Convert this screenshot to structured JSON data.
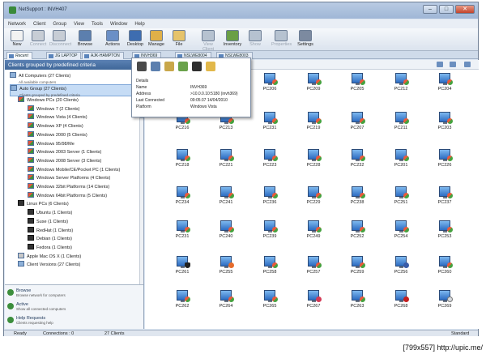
{
  "window": {
    "title": "NetSupport : INVH407"
  },
  "menu": [
    "Network",
    "Client",
    "Group",
    "View",
    "Tools",
    "Window",
    "Help"
  ],
  "toolbar": [
    {
      "label": "New",
      "icon": "new-icon",
      "enabled": true
    },
    {
      "label": "Connect",
      "icon": "connect-icon",
      "enabled": false
    },
    {
      "label": "Disconnect",
      "icon": "disconnect-icon",
      "enabled": false
    },
    {
      "label": "Browse",
      "icon": "browse-icon",
      "enabled": true
    },
    {
      "label": "Actions",
      "icon": "actions-icon",
      "enabled": true
    },
    {
      "label": "Desktop",
      "icon": "desktop-icon",
      "enabled": true
    },
    {
      "label": "Manage",
      "icon": "manage-icon",
      "enabled": true
    },
    {
      "label": "File",
      "icon": "file-icon",
      "enabled": true
    },
    {
      "label": "View Client",
      "icon": "view-client-icon",
      "enabled": false
    },
    {
      "label": "Inventory",
      "icon": "inventory-icon",
      "enabled": true
    },
    {
      "label": "Show",
      "icon": "show-icon",
      "enabled": false
    },
    {
      "label": "Properties",
      "icon": "properties-icon",
      "enabled": false
    },
    {
      "label": "Settings",
      "icon": "settings-icon",
      "enabled": true
    }
  ],
  "tabs": [
    "Recent",
    "JG LAPTOP",
    "AJK-HAMPTON",
    "INVH369",
    "NSLWE8004",
    "NSLWE8003"
  ],
  "left_panel": {
    "title": "Clients grouped by predefined criteria",
    "tree": [
      {
        "label": "All Computers (27 Clients)",
        "sub": "All available computers",
        "icon": "computer"
      },
      {
        "label": "Auto Group (27 Clients)",
        "sub": "Clients grouped by predefined criteria",
        "icon": "group",
        "selected": true
      },
      {
        "label": "Windows PCs (20 Clients)",
        "icon": "win"
      },
      {
        "label": "Windows 7 (2 Clients)",
        "icon": "win"
      },
      {
        "label": "Windows Vista (4 Clients)",
        "icon": "win"
      },
      {
        "label": "Windows XP (4 Clients)",
        "icon": "win"
      },
      {
        "label": "Windows 2000 (5 Clients)",
        "icon": "win"
      },
      {
        "label": "Windows 95/98/Me",
        "icon": "win"
      },
      {
        "label": "Windows 2003 Server (1 Clients)",
        "icon": "win"
      },
      {
        "label": "Windows 2008 Server (3 Clients)",
        "icon": "win"
      },
      {
        "label": "Windows Mobile/CE/Pocket PC (1 Clients)",
        "icon": "win"
      },
      {
        "label": "Windows Server Platforms (4 Clients)",
        "icon": "win"
      },
      {
        "label": "Windows 32bit Platforms (14 Clients)",
        "icon": "win"
      },
      {
        "label": "Windows 64bit Platforms (5 Clients)",
        "icon": "win"
      },
      {
        "label": "Linux PCs (6 Clients)",
        "icon": "lin"
      },
      {
        "label": "Ubuntu (1 Clients)",
        "icon": "lin"
      },
      {
        "label": "Suse (1 Clients)",
        "icon": "lin"
      },
      {
        "label": "RedHat (1 Clients)",
        "icon": "lin"
      },
      {
        "label": "Debian (1 Clients)",
        "icon": "lin"
      },
      {
        "label": "Fedora (1 Clients)",
        "icon": "lin"
      },
      {
        "label": "Apple Mac OS X (1 Clients)",
        "icon": "apple"
      },
      {
        "label": "Client Versions (27 Clients)",
        "icon": "group"
      }
    ],
    "footer": [
      {
        "label": "Browse",
        "desc": "Browse network for computers"
      },
      {
        "label": "Active",
        "desc": "Show all connected computers"
      },
      {
        "label": "Help Requests",
        "desc": "Clients requesting help"
      }
    ]
  },
  "clients": [
    "PC206",
    "PC209",
    "PC205",
    "PC212",
    "PC204",
    "PC216",
    "PC213",
    "PC231",
    "PC219",
    "PC207",
    "PC211",
    "PC203",
    "PC218",
    "PC221",
    "PC223",
    "PC228",
    "PC232",
    "PC201",
    "PC226",
    "PC234",
    "PC241",
    "PC236",
    "PC229",
    "PC238",
    "PC251",
    "PC237",
    "PC231",
    "PC240",
    "PC239",
    "PC249",
    "PC252",
    "PC254",
    "PC253",
    "PC261",
    "PC255",
    "PC258",
    "PC257",
    "PC259",
    "PC256",
    "PC260",
    "PC262",
    "PC264",
    "PC265",
    "PC267",
    "PC263",
    "PC268",
    "PC269"
  ],
  "client_badges": [
    "win",
    "win",
    "win",
    "win",
    "win",
    "win",
    "win",
    "win",
    "win",
    "win",
    "win",
    "win",
    "win",
    "win",
    "win",
    "win",
    "win",
    "win",
    "win",
    "win",
    "win",
    "win",
    "win",
    "win",
    "win",
    "win",
    "win",
    "win",
    "win",
    "win",
    "win",
    "win",
    "win",
    "lin",
    "ubu",
    "win",
    "win",
    "win",
    "fed",
    "win",
    "win",
    "win",
    "win",
    "dbn",
    "win",
    "red",
    "mac"
  ],
  "popup": {
    "section": "Details",
    "rows": [
      {
        "key": "Name",
        "value": "INVH369"
      },
      {
        "key": "Address",
        "value": ">10.0.0.10:5180 (invh369)"
      },
      {
        "key": "Last Connected",
        "value": "09:05:37 14/04/2010"
      },
      {
        "key": "Platform",
        "value": "Windows Vista"
      }
    ]
  },
  "status": {
    "state": "Ready",
    "connections": "Connections : 0",
    "clients": "27 Clients",
    "mode": "Standard"
  },
  "watermark": "[799x557] http://upic.me/"
}
